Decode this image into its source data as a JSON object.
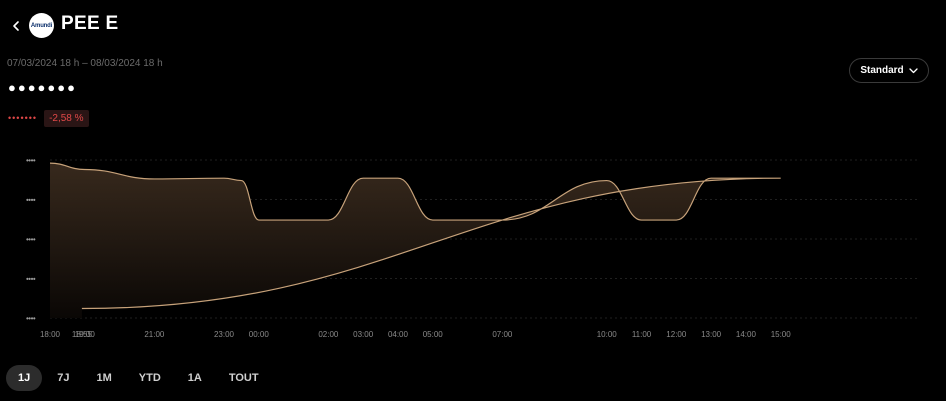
{
  "header": {
    "back_icon": "chevron-left-icon",
    "logo_text": "Amundi",
    "title": "PEE E"
  },
  "date_range": "07/03/2024 18 h – 08/03/2024 18 h",
  "value_masked": "●●●●●●●",
  "performance": {
    "masked": "•••••••",
    "percent": "-2,58 %",
    "color": "#e04848"
  },
  "view_select": {
    "label": "Standard",
    "icon": "chevron-down-icon"
  },
  "colors": {
    "line": "#c7a27a",
    "background": "#000000"
  },
  "chart_data": {
    "type": "area",
    "y_tick_labels": [
      "••••",
      "••••",
      "••••",
      "••••",
      "••••"
    ],
    "x_tick_labels": [
      "18:00",
      "19:00",
      "21:00",
      "23:00",
      "00:00",
      "02:00",
      "03:00",
      "04:00",
      "05:00",
      "07:00",
      "10:00",
      "11:00",
      "12:00",
      "13:00",
      "14:00",
      "15:00",
      "18:55"
    ],
    "ylim": [
      0,
      1
    ],
    "grid": true,
    "series": [
      {
        "values": [
          {
            "x": "18:00",
            "y": 0.98
          },
          {
            "x": "19:00",
            "y": 0.94
          },
          {
            "x": "21:00",
            "y": 0.88
          },
          {
            "x": "23:00",
            "y": 0.885
          },
          {
            "x": "23:30",
            "y": 0.87
          },
          {
            "x": "00:00",
            "y": 0.62
          },
          {
            "x": "02:00",
            "y": 0.62
          },
          {
            "x": "03:00",
            "y": 0.885
          },
          {
            "x": "04:00",
            "y": 0.885
          },
          {
            "x": "05:00",
            "y": 0.62
          },
          {
            "x": "07:00",
            "y": 0.62
          },
          {
            "x": "10:00",
            "y": 0.87
          },
          {
            "x": "11:00",
            "y": 0.62
          },
          {
            "x": "12:00",
            "y": 0.62
          },
          {
            "x": "13:00",
            "y": 0.885
          },
          {
            "x": "15:00",
            "y": 0.885
          },
          {
            "x": "18:55",
            "y": 0.06
          }
        ]
      }
    ]
  },
  "ranges": {
    "r1": "1J",
    "r2": "7J",
    "r3": "1M",
    "r4": "YTD",
    "r5": "1A",
    "r6": "TOUT",
    "active": "1J"
  }
}
